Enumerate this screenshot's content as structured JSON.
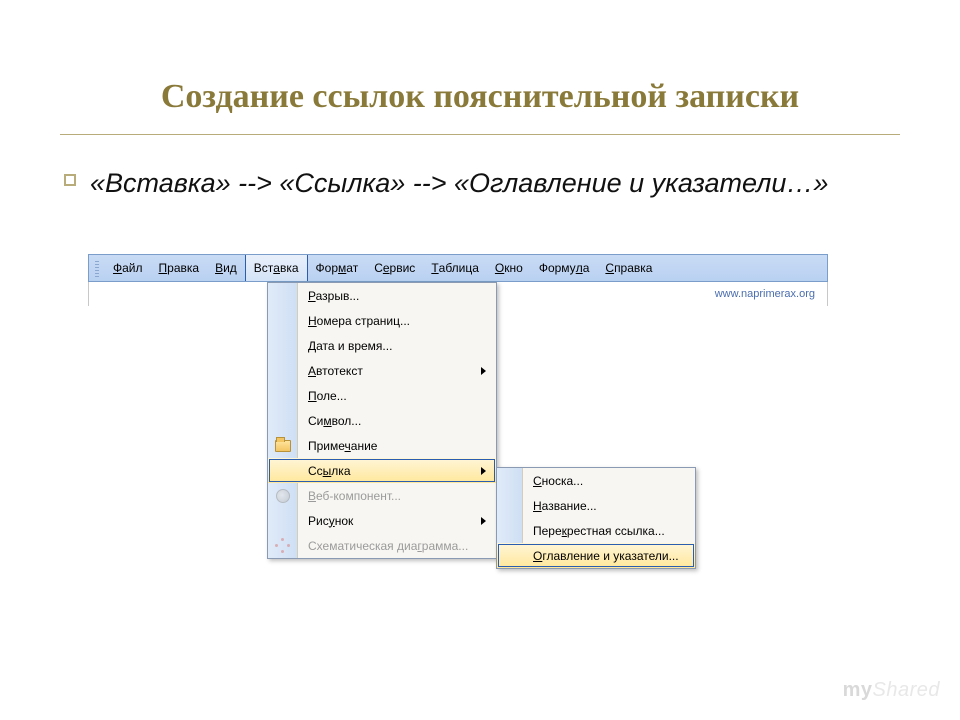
{
  "slide": {
    "title": "Создание ссылок пояснительной записки",
    "bullet_text": "«Вставка» --> «Ссылка» --> «Оглавление и указатели…»"
  },
  "menubar": {
    "items": [
      {
        "label": "Файл",
        "accel": "Ф"
      },
      {
        "label": "Правка",
        "accel": "П"
      },
      {
        "label": "Вид",
        "accel": "В"
      },
      {
        "label": "Вставка",
        "accel": "а",
        "active": true
      },
      {
        "label": "Формат",
        "accel": "м"
      },
      {
        "label": "Сервис",
        "accel": "е"
      },
      {
        "label": "Таблица",
        "accel": "Т"
      },
      {
        "label": "Окно",
        "accel": "О"
      },
      {
        "label": "Формула",
        "accel": "л"
      },
      {
        "label": "Справка",
        "accel": "С"
      }
    ]
  },
  "watermark": "www.naprimerax.org",
  "dropdown": {
    "items": [
      {
        "label": "Разрыв...",
        "accel": "Р"
      },
      {
        "label": "Номера страниц...",
        "accel": "Н"
      },
      {
        "label": "Дата и время...",
        "accel": "Д"
      },
      {
        "label": "Автотекст",
        "accel": "А",
        "submenu": true
      },
      {
        "label": "Поле...",
        "accel": "П"
      },
      {
        "label": "Символ...",
        "accel": "м"
      },
      {
        "label": "Примечание",
        "accel": "ч",
        "icon": "folder"
      },
      {
        "label": "Ссылка",
        "accel": "ы",
        "submenu": true,
        "highlight": true
      },
      {
        "label": "Веб-компонент...",
        "accel": "В",
        "disabled": true,
        "icon": "globe"
      },
      {
        "label": "Рисунок",
        "accel": "у",
        "submenu": true
      },
      {
        "label": "Схематическая диаграмма...",
        "accel": "г",
        "disabled": true,
        "icon": "dots"
      }
    ]
  },
  "submenu": {
    "items": [
      {
        "label": "Сноска...",
        "accel": "С"
      },
      {
        "label": "Название...",
        "accel": "Н"
      },
      {
        "label": "Перекрестная ссылка...",
        "accel": "к"
      },
      {
        "label": "Оглавление и указатели...",
        "accel": "О",
        "highlight": true
      }
    ]
  },
  "brand": {
    "part1": "my",
    "part2": "Shared"
  }
}
